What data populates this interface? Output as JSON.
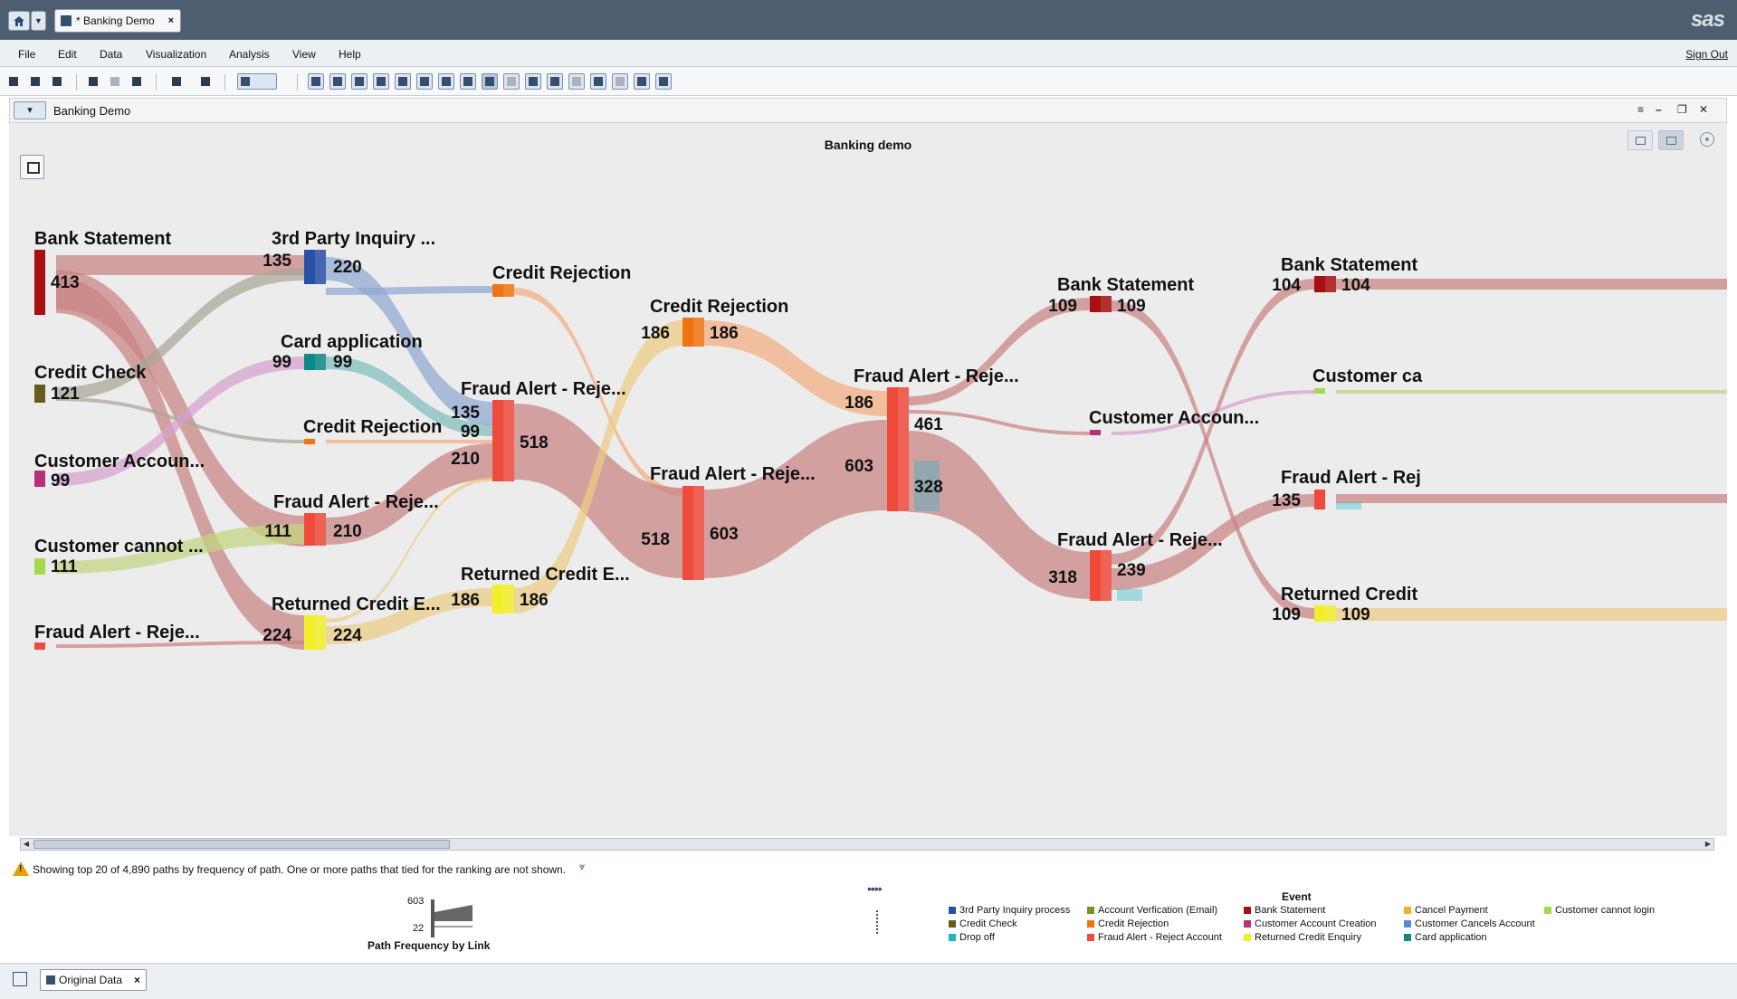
{
  "window": {
    "doc_tab_title": "* Banking Demo",
    "close_glyph": "×",
    "brand": "sas"
  },
  "menu": {
    "items": [
      "File",
      "Edit",
      "Data",
      "Visualization",
      "Analysis",
      "View",
      "Help"
    ],
    "sign_out": "Sign Out"
  },
  "section": {
    "title": "Banking Demo"
  },
  "chart": {
    "title": "Banking demo"
  },
  "chart_data": {
    "type": "sankey",
    "title": "Banking demo",
    "nodes": [
      {
        "id": "n1",
        "label": "Bank Statement",
        "values": [
          "413"
        ],
        "event": "Bank Statement"
      },
      {
        "id": "n2",
        "label": "Credit Check",
        "values": [
          "121"
        ],
        "event": "Credit Check"
      },
      {
        "id": "n3",
        "label": "Customer Accoun...",
        "values": [
          "99"
        ],
        "event": "Customer Account Creation"
      },
      {
        "id": "n4",
        "label": "Customer cannot ...",
        "values": [
          "111"
        ],
        "event": "Customer cannot login"
      },
      {
        "id": "n5",
        "label": "Fraud Alert - Reje...",
        "values": [],
        "event": "Fraud Alert - Reject Account"
      },
      {
        "id": "n6",
        "label": "3rd Party Inquiry ...",
        "values": [
          "135",
          "220"
        ],
        "event": "3rd Party Inquiry process"
      },
      {
        "id": "n7",
        "label": "Card application",
        "values": [
          "99",
          "99"
        ],
        "event": "Card application"
      },
      {
        "id": "n8",
        "label": "Credit Rejection",
        "values": [],
        "event": "Credit Rejection"
      },
      {
        "id": "n9",
        "label": "Fraud Alert - Reje...",
        "values": [
          "111",
          "210"
        ],
        "event": "Fraud Alert - Reject Account"
      },
      {
        "id": "n10",
        "label": "Returned Credit E...",
        "values": [
          "224",
          "224"
        ],
        "event": "Returned Credit Enquiry"
      },
      {
        "id": "n11",
        "label": "Credit Rejection",
        "values": [],
        "event": "Credit Rejection"
      },
      {
        "id": "n12",
        "label": "Fraud Alert - Reje...",
        "values": [
          "135",
          "99",
          "210",
          "518"
        ],
        "event": "Fraud Alert - Reject Account"
      },
      {
        "id": "n13",
        "label": "Returned Credit E...",
        "values": [
          "186",
          "186"
        ],
        "event": "Returned Credit Enquiry"
      },
      {
        "id": "n14",
        "label": "Credit Rejection",
        "values": [
          "186",
          "186"
        ],
        "event": "Credit Rejection"
      },
      {
        "id": "n15",
        "label": "Fraud Alert - Reje...",
        "values": [
          "518",
          "603"
        ],
        "event": "Fraud Alert - Reject Account"
      },
      {
        "id": "n16",
        "label": "Fraud Alert - Reje...",
        "values": [
          "186",
          "603",
          "461",
          "328"
        ],
        "event": "Fraud Alert - Reject Account"
      },
      {
        "id": "n17",
        "label": "Bank Statement",
        "values": [
          "109",
          "109"
        ],
        "event": "Bank Statement"
      },
      {
        "id": "n18",
        "label": "Customer Accoun...",
        "values": [],
        "event": "Customer Account Creation"
      },
      {
        "id": "n19",
        "label": "Fraud Alert - Reje...",
        "values": [
          "318",
          "239"
        ],
        "event": "Fraud Alert - Reject Account"
      },
      {
        "id": "n20",
        "label": "Bank Statement",
        "values": [
          "104",
          "104"
        ],
        "event": "Bank Statement"
      },
      {
        "id": "n21",
        "label": "Customer ca",
        "values": [],
        "event": "Customer cannot login"
      },
      {
        "id": "n22",
        "label": "Fraud Alert - Rej",
        "values": [
          "135"
        ],
        "event": "Fraud Alert - Reject Account"
      },
      {
        "id": "n23",
        "label": "Returned Credit",
        "values": [
          "109",
          "109"
        ],
        "event": "Returned Credit Enquiry"
      }
    ],
    "links": [
      {
        "from": "n1",
        "to": "n6",
        "value": 135,
        "event": "Bank Statement"
      },
      {
        "from": "n1",
        "to": "n9",
        "value": 210,
        "event": "Bank Statement"
      },
      {
        "from": "n1",
        "to": "n10",
        "value": 224,
        "event": "Bank Statement"
      },
      {
        "from": "n2",
        "to": "n6",
        "value": 121,
        "event": "Credit Check"
      },
      {
        "from": "n2",
        "to": "n8",
        "value": 22,
        "event": "Credit Check"
      },
      {
        "from": "n3",
        "to": "n7",
        "value": 99,
        "event": "Customer Account Creation"
      },
      {
        "from": "n4",
        "to": "n9",
        "value": 111,
        "event": "Customer cannot login"
      },
      {
        "from": "n5",
        "to": "n10",
        "value": 22,
        "event": "Fraud Alert - Reject Account"
      },
      {
        "from": "n6",
        "to": "n11",
        "value": 22,
        "event": "3rd Party Inquiry process"
      },
      {
        "from": "n6",
        "to": "n12",
        "value": 135,
        "event": "3rd Party Inquiry process"
      },
      {
        "from": "n7",
        "to": "n12",
        "value": 99,
        "event": "Card application"
      },
      {
        "from": "n8",
        "to": "n12",
        "value": 22,
        "event": "Credit Rejection"
      },
      {
        "from": "n9",
        "to": "n12",
        "value": 210,
        "event": "Fraud Alert - Reject Account"
      },
      {
        "from": "n10",
        "to": "n12",
        "value": 22,
        "event": "Returned Credit Enquiry"
      },
      {
        "from": "n10",
        "to": "n13",
        "value": 186,
        "event": "Returned Credit Enquiry"
      },
      {
        "from": "n11",
        "to": "n15",
        "value": 22,
        "event": "Credit Rejection"
      },
      {
        "from": "n12",
        "to": "n15",
        "value": 518,
        "event": "Fraud Alert - Reject Account"
      },
      {
        "from": "n13",
        "to": "n14",
        "value": 186,
        "event": "Returned Credit Enquiry"
      },
      {
        "from": "n14",
        "to": "n16",
        "value": 186,
        "event": "Credit Rejection"
      },
      {
        "from": "n15",
        "to": "n16",
        "value": 603,
        "event": "Fraud Alert - Reject Account"
      },
      {
        "from": "n16",
        "to": "n17",
        "value": 109,
        "event": "Fraud Alert - Reject Account"
      },
      {
        "from": "n16",
        "to": "n18",
        "value": 22,
        "event": "Fraud Alert - Reject Account"
      },
      {
        "from": "n16",
        "to": "n19",
        "value": 318,
        "event": "Fraud Alert - Reject Account"
      },
      {
        "from": "n17",
        "to": "n23",
        "value": 109,
        "event": "Bank Statement"
      },
      {
        "from": "n18",
        "to": "n21",
        "value": 22,
        "event": "Customer Account Creation"
      },
      {
        "from": "n19",
        "to": "n20",
        "value": 104,
        "event": "Fraud Alert - Reject Account"
      },
      {
        "from": "n19",
        "to": "n22",
        "value": 135,
        "event": "Fraud Alert - Reject Account"
      }
    ]
  },
  "status": {
    "message": "Showing top 20 of 4,890 paths by frequency of path. One or more paths that tied for the ranking are not shown."
  },
  "path_frequency": {
    "label": "Path Frequency by Link",
    "max": "603",
    "min": "22"
  },
  "legend": {
    "title": "Event",
    "items": [
      {
        "label": "3rd Party Inquiry process",
        "color": "#2a4fa8"
      },
      {
        "label": "Credit Check",
        "color": "#6b5a1e"
      },
      {
        "label": "Drop off",
        "color": "#19b8c9"
      },
      {
        "label": "Account Verfication (Email)",
        "color": "#6e9a1f"
      },
      {
        "label": "Credit Rejection",
        "color": "#f07410"
      },
      {
        "label": "Fraud Alert - Reject Account",
        "color": "#f04a3c"
      },
      {
        "label": "Bank Statement",
        "color": "#a80f10"
      },
      {
        "label": "Customer Account Creation",
        "color": "#b6307a"
      },
      {
        "label": "Returned Credit Enquiry",
        "color": "#f2ee2a"
      },
      {
        "label": "Cancel Payment",
        "color": "#f0b12c"
      },
      {
        "label": "Customer Cancels Account",
        "color": "#5b86d6"
      },
      {
        "label": "Card application",
        "color": "#0e8a86"
      },
      {
        "label": "Customer cannot login",
        "color": "#a6d84e"
      }
    ]
  },
  "bottom": {
    "data_tab": "Original Data"
  }
}
